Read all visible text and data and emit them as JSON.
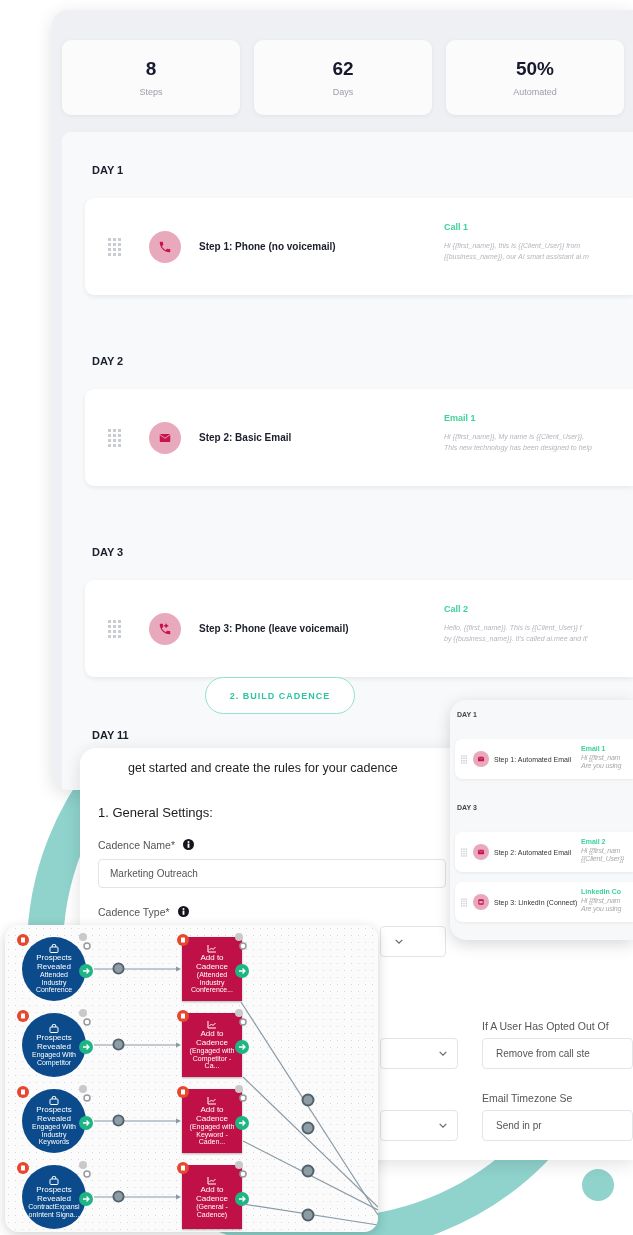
{
  "stats": [
    {
      "value": "8",
      "label": "Steps"
    },
    {
      "value": "62",
      "label": "Days"
    },
    {
      "value": "50%",
      "label": "Automated"
    }
  ],
  "days": [
    {
      "label": "DAY 1",
      "steps": [
        {
          "kind": "phone",
          "title": "Step 1: Phone (no voicemail)",
          "message_title": "Call 1",
          "message_lines": [
            "Hi {{first_name}}, this is {{Client_User}} from",
            "{{business_name}}, our AI smart assistant ai.m"
          ]
        }
      ]
    },
    {
      "label": "DAY 2",
      "steps": [
        {
          "kind": "email",
          "title": "Step 2: Basic Email",
          "message_title": "Email 1",
          "message_lines": [
            "Hi {{first_name}}, My name is {{Client_User}},",
            "This new technology has been designed to help"
          ]
        }
      ]
    },
    {
      "label": "DAY 3",
      "steps": [
        {
          "kind": "voicemail",
          "title": "Step 3: Phone (leave voicemail)",
          "message_title": "Call 2",
          "message_lines": [
            "Hello, {{first_name}}. This is {{Client_User}} f",
            "by {{business_name}}. It's called ai.mee and it'"
          ]
        }
      ]
    }
  ],
  "build_button": {
    "label": "2. BUILD CADENCE"
  },
  "next_day": {
    "label": "DAY 11"
  },
  "form": {
    "intro": "get started and create the rules for your cadence",
    "section_title": "1. General Settings:",
    "fields": [
      {
        "kind": "text",
        "label": "Cadence Name*",
        "value": "Marketing Outreach"
      },
      {
        "kind": "select",
        "label": "Cadence Type*"
      }
    ],
    "columns": [
      [
        {
          "kind": "select"
        },
        {
          "kind": "select"
        }
      ],
      [
        {
          "kind": "select",
          "label": "If A User Has Opted Out Of",
          "value": "Remove from call ste"
        },
        {
          "kind": "select",
          "label": "Email Timezone Se",
          "value": "Send in pr"
        }
      ]
    ]
  },
  "preview": {
    "days": [
      {
        "label": "DAY 1",
        "steps": [
          {
            "kind": "email",
            "title": "Step 1: Automated Email",
            "message_title": "Email 1",
            "message_lines": [
              "Hi {{first_nam",
              "Are you using"
            ]
          }
        ]
      },
      {
        "label": "DAY 3",
        "steps": [
          {
            "kind": "email",
            "title": "Step 2: Automated Email",
            "message_title": "Email 2",
            "message_lines": [
              "Hi {{first_nam",
              "{{Client_User}}"
            ]
          },
          {
            "kind": "linkedin",
            "title": "Step 3: LinkedIn (Connect)",
            "message_title": "LinkedIn Co",
            "message_lines": [
              "Hi {{first_nam",
              "Are you using"
            ]
          }
        ]
      }
    ]
  },
  "flow": {
    "rows": [
      {
        "source": {
          "title": "Prospects Revealed",
          "subtitle": "Attended Industry Conference"
        },
        "target": {
          "title": "Add to Cadence",
          "subtitle": "(Attended Industry Conference..."
        }
      },
      {
        "source": {
          "title": "Prospects Revealed",
          "subtitle": "Engaged With Competitor"
        },
        "target": {
          "title": "Add to Cadence",
          "subtitle": "(Engaged with Competitor - Ca..."
        }
      },
      {
        "source": {
          "title": "Prospects Revealed",
          "subtitle": "Engaged With Industry Keywords"
        },
        "target": {
          "title": "Add to Cadence",
          "subtitle": "(Engaged with Keyword - Caden..."
        }
      },
      {
        "source": {
          "title": "Prospects Revealed",
          "subtitle": "ContractExpansionIntent Signa..."
        },
        "target": {
          "title": "Add to Cadence",
          "subtitle": "(General - Cadence)"
        }
      }
    ]
  }
}
